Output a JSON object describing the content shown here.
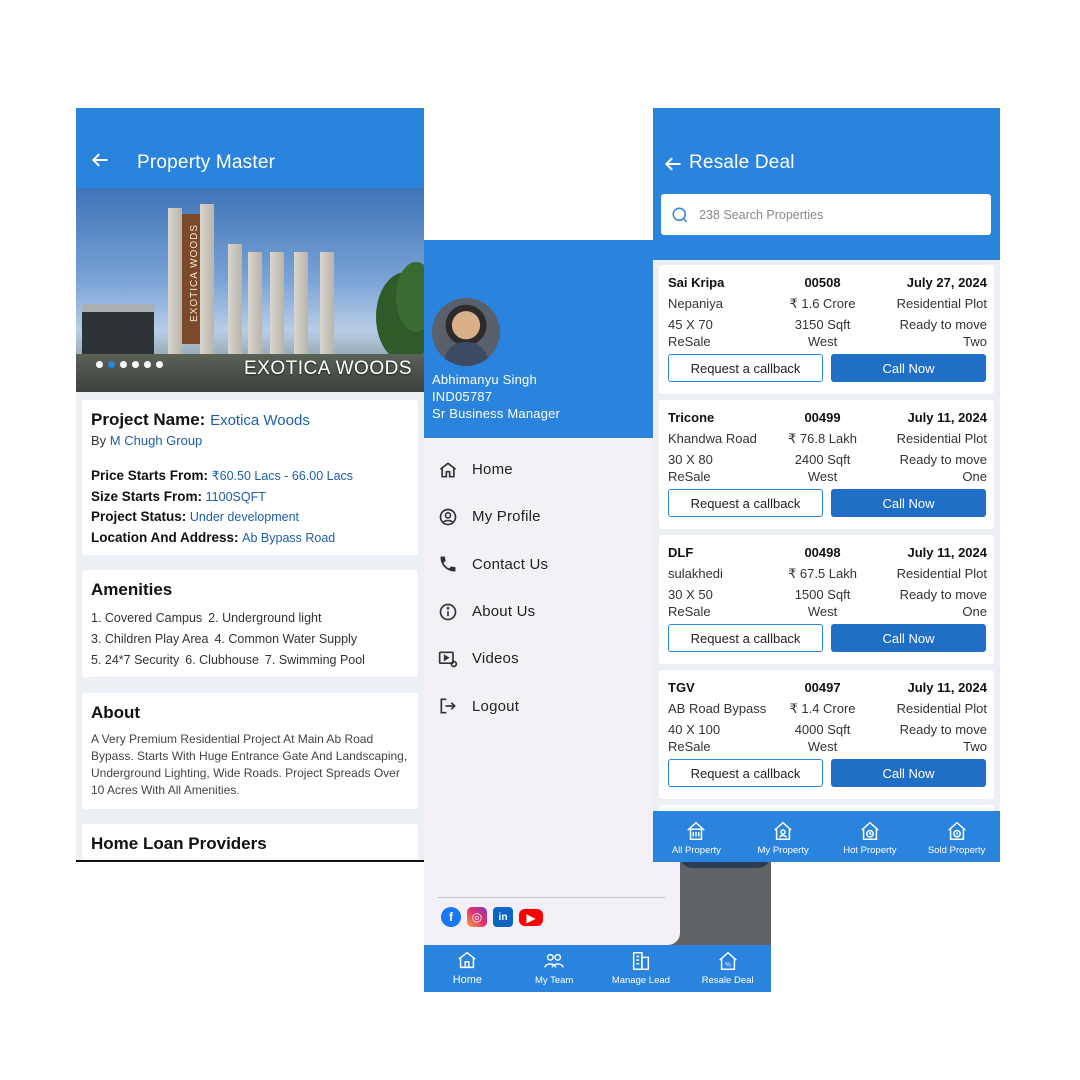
{
  "property_master": {
    "title": "Property Master",
    "hero_caption": "EXOTICA WOODS",
    "hero_board": "EXOTICA WOODS",
    "slide_count": 6,
    "active_slide": 2,
    "project": {
      "name_label": "Project Name:",
      "name": "Exotica Woods",
      "by_label": "By",
      "by": "M Chugh Group",
      "price_label": "Price Starts From:",
      "price": "₹60.50 Lacs - 66.00 Lacs",
      "size_label": "Size Starts From:",
      "size": "1100SQFT",
      "status_label": "Project Status:",
      "status": "Under development",
      "location_label": "Location And Address:",
      "location": "Ab Bypass Road"
    },
    "amenities": {
      "title": "Amenities",
      "items": [
        "1. Covered Campus",
        "2. Underground light",
        "3. Children Play Area",
        "4. Common Water Supply",
        "5. 24*7 Security",
        "6. Clubhouse",
        "7. Swimming Pool"
      ]
    },
    "about": {
      "title": "About",
      "text": "A Very Premium Residential Project At Main Ab Road Bypass. Starts With Huge Entrance Gate And Landscaping, Underground Lighting, Wide Roads. Project Spreads Over 10 Acres With All Amenities."
    },
    "loans": {
      "title": "Home Loan Providers"
    }
  },
  "drawer": {
    "user": {
      "name": "Abhimanyu Singh",
      "id": "IND05787",
      "role": "Sr Business Manager"
    },
    "menu": [
      {
        "label": "Home",
        "icon": "home-icon"
      },
      {
        "label": "My Profile",
        "icon": "profile-icon"
      },
      {
        "label": "Contact Us",
        "icon": "phone-icon"
      },
      {
        "label": "About Us",
        "icon": "info-icon"
      },
      {
        "label": "Videos",
        "icon": "video-settings-icon"
      },
      {
        "label": "Logout",
        "icon": "logout-icon"
      }
    ],
    "socials": [
      "facebook-icon",
      "instagram-icon",
      "linkedin-icon",
      "youtube-icon"
    ],
    "bottom_nav": [
      {
        "label": "Home",
        "icon": "home-icon"
      },
      {
        "label": "My Team",
        "icon": "team-icon"
      },
      {
        "label": "Manage Lead",
        "icon": "building-icon"
      },
      {
        "label": "Resale Deal",
        "icon": "resale-house-icon"
      }
    ]
  },
  "resale": {
    "title": "Resale Deal",
    "search_placeholder": "238 Search Properties",
    "callback_label": "Request a callback",
    "call_label": "Call Now",
    "deals": [
      {
        "name": "Sai Kripa",
        "code": "00508",
        "date": "July 27, 2024",
        "location": "Nepaniya",
        "price": "₹ 1.6 Crore",
        "type": "Residential Plot",
        "dims": "45 X 70",
        "area": "3150 Sqft",
        "status": "Ready to move",
        "sale": "ReSale",
        "facing": "West",
        "wheeler": "Two"
      },
      {
        "name": "Tricone",
        "code": "00499",
        "date": "July 11, 2024",
        "location": "Khandwa Road",
        "price": "₹ 76.8 Lakh",
        "type": "Residential Plot",
        "dims": "30 X 80",
        "area": "2400 Sqft",
        "status": "Ready to move",
        "sale": "ReSale",
        "facing": "West",
        "wheeler": "One"
      },
      {
        "name": "DLF",
        "code": "00498",
        "date": "July 11, 2024",
        "location": "sulakhedi",
        "price": "₹ 67.5 Lakh",
        "type": "Residential Plot",
        "dims": "30 X 50",
        "area": "1500 Sqft",
        "status": "Ready to move",
        "sale": "ReSale",
        "facing": "West",
        "wheeler": "One"
      },
      {
        "name": "TGV",
        "code": "00497",
        "date": "July 11, 2024",
        "location": "AB Road Bypass",
        "price": "₹ 1.4 Crore",
        "type": "Residential Plot",
        "dims": "40 X 100",
        "area": "4000 Sqft",
        "status": "Ready to move",
        "sale": "ReSale",
        "facing": "West",
        "wheeler": "Two"
      }
    ],
    "bottom_nav": [
      {
        "label": "All Property",
        "icon": "all-property-icon"
      },
      {
        "label": "My Property",
        "icon": "my-property-icon"
      },
      {
        "label": "Hot Property",
        "icon": "hot-property-icon"
      },
      {
        "label": "Sold Property",
        "icon": "sold-property-icon"
      }
    ]
  },
  "colors": {
    "primary": "#2a83dc",
    "button": "#1f6fc6",
    "link": "#1f5fa6"
  }
}
